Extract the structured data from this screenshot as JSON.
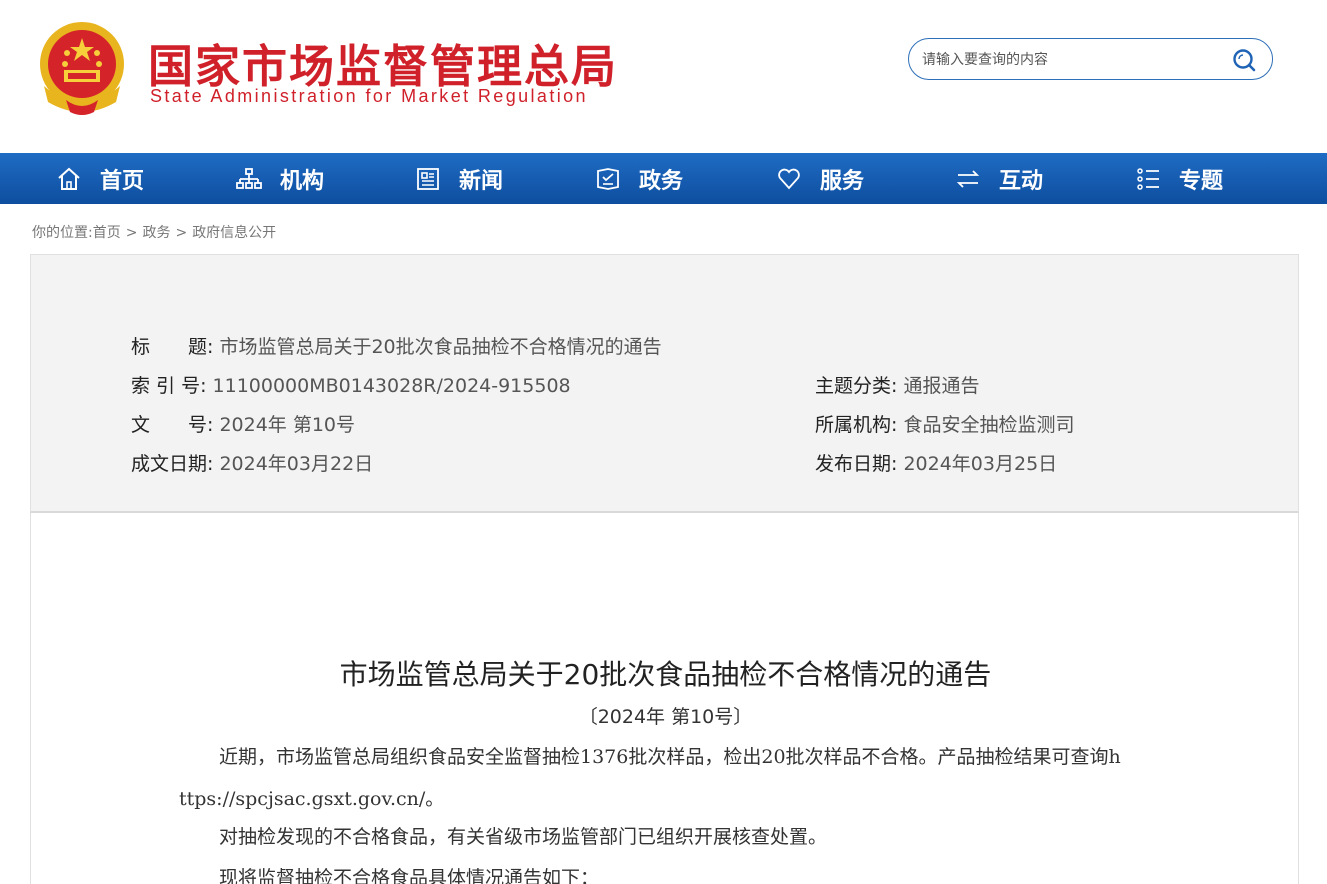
{
  "header": {
    "title_cn": "国家市场监督管理总局",
    "title_en": "State Administration for Market Regulation",
    "search_placeholder": "请输入要查询的内容"
  },
  "nav": {
    "items": [
      {
        "label": "首页",
        "icon": "home-icon"
      },
      {
        "label": "机构",
        "icon": "org-chart-icon"
      },
      {
        "label": "新闻",
        "icon": "news-icon"
      },
      {
        "label": "政务",
        "icon": "gov-affairs-icon"
      },
      {
        "label": "服务",
        "icon": "heart-icon"
      },
      {
        "label": "互动",
        "icon": "exchange-icon"
      },
      {
        "label": "专题",
        "icon": "topic-list-icon"
      }
    ]
  },
  "breadcrumb": {
    "prefix": "你的位置:",
    "items": [
      "首页",
      "政务",
      "政府信息公开"
    ],
    "separator": ">"
  },
  "info": {
    "title_key": "标　　题:",
    "title_val": "市场监管总局关于20批次食品抽检不合格情况的通告",
    "index_key": "索 引 号:",
    "index_val": "11100000MB0143028R/2024-915508",
    "docnum_key": "文　　号:",
    "docnum_val": "2024年 第10号",
    "created_key": "成文日期:",
    "created_val": "2024年03月22日",
    "category_key": "主题分类:",
    "category_val": "通报通告",
    "agency_key": "所属机构:",
    "agency_val": "食品安全抽检监测司",
    "published_key": "发布日期:",
    "published_val": "2024年03月25日"
  },
  "article": {
    "title": "市场监管总局关于20批次食品抽检不合格情况的通告",
    "doc_no": "〔2024年 第10号〕",
    "para1_line1": "近期，市场监管总局组织食品安全监督抽检1376批次样品，检出20批次样品不合格。产品抽检结果可查询h",
    "para1_line2": "ttps://spcjsac.gsxt.gov.cn/。",
    "para2": "对抽检发现的不合格食品，有关省级市场监管部门已组织开展核查处置。",
    "para3": "现将监督抽检不合格食品具体情况通告如下："
  },
  "colors": {
    "brand_red": "#d0202a",
    "nav_blue": "#1560b5",
    "panel_bg": "#f3f3f3"
  }
}
